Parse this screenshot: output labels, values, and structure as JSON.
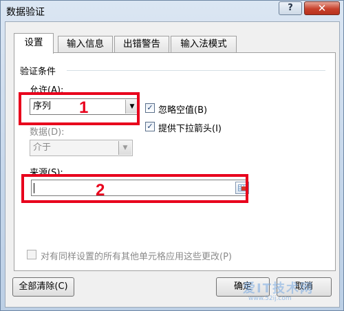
{
  "window": {
    "title": "数据验证",
    "help_label": "?",
    "close_label": "✕"
  },
  "tabs": [
    {
      "label": "设置",
      "active": true
    },
    {
      "label": "输入信息",
      "active": false
    },
    {
      "label": "出错警告",
      "active": false
    },
    {
      "label": "输入法模式",
      "active": false
    }
  ],
  "validation": {
    "group_title": "验证条件",
    "allow_label": "允许(A):",
    "allow_value": "序列",
    "ignore_blank_label": "忽略空值(B)",
    "ignore_blank_checked": true,
    "dropdown_label": "提供下拉箭头(I)",
    "dropdown_checked": true,
    "data_label": "数据(D):",
    "data_value": "介于",
    "source_label": "来源(S):",
    "source_value": ""
  },
  "apply_all_label": "对有同样设置的所有其他单元格应用这些更改(P)",
  "buttons": {
    "clear_all": "全部清除(C)",
    "ok": "确定",
    "cancel": "取消"
  },
  "annotations": {
    "callout_1": "1",
    "callout_2": "2",
    "highlight_color": "#e8001c"
  },
  "watermark": {
    "text": "爱IT技术网",
    "url": "www.52ij.com"
  },
  "icons": {
    "dropdown_arrow": "chevron-down-icon",
    "checkbox_check": "checkmark-icon",
    "range_picker": "range-selector-icon"
  }
}
